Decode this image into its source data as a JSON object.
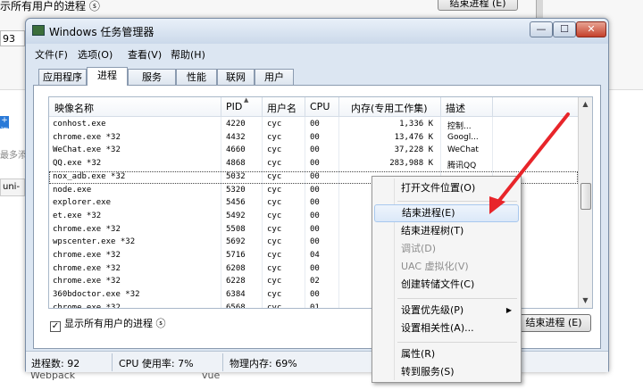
{
  "background": {
    "top_text": "示所有用户的进程 ⓢ",
    "top_button": "结束进程 (E)",
    "num_field": "93",
    "side_text_1": "+ 添",
    "side_text_2": "最多添",
    "side_text_3": "uni-",
    "bottom_text_1": "Webpack",
    "bottom_text_2": "vue"
  },
  "window": {
    "title": "Windows 任务管理器",
    "min": "—",
    "max": "☐",
    "close": "✕"
  },
  "menu": {
    "file": "文件(F)",
    "options": "选项(O)",
    "view": "查看(V)",
    "help": "帮助(H)"
  },
  "tabs": {
    "apps": "应用程序",
    "processes": "进程",
    "services": "服务",
    "performance": "性能",
    "network": "联网",
    "users": "用户"
  },
  "columns": {
    "name": "映像名称",
    "pid": "PID",
    "user": "用户名",
    "cpu": "CPU",
    "mem": "内存(专用工作集)",
    "desc": "描述"
  },
  "processes": [
    {
      "name": "conhost.exe",
      "pid": "4220",
      "user": "cyc",
      "cpu": "00",
      "mem": "1,336 K",
      "desc": "控制..."
    },
    {
      "name": "chrome.exe *32",
      "pid": "4432",
      "user": "cyc",
      "cpu": "00",
      "mem": "13,476 K",
      "desc": "Googl..."
    },
    {
      "name": "WeChat.exe *32",
      "pid": "4660",
      "user": "cyc",
      "cpu": "00",
      "mem": "37,228 K",
      "desc": "WeChat"
    },
    {
      "name": "QQ.exe *32",
      "pid": "4868",
      "user": "cyc",
      "cpu": "00",
      "mem": "283,988 K",
      "desc": "腾讯QQ"
    },
    {
      "name": "nox_adb.exe *32",
      "pid": "5032",
      "user": "cyc",
      "cpu": "00",
      "mem": "",
      "desc": ""
    },
    {
      "name": "node.exe",
      "pid": "5320",
      "user": "cyc",
      "cpu": "00",
      "mem": "",
      "desc": ""
    },
    {
      "name": "explorer.exe",
      "pid": "5456",
      "user": "cyc",
      "cpu": "00",
      "mem": "",
      "desc": ""
    },
    {
      "name": "et.exe *32",
      "pid": "5492",
      "user": "cyc",
      "cpu": "00",
      "mem": "",
      "desc": ""
    },
    {
      "name": "chrome.exe *32",
      "pid": "5508",
      "user": "cyc",
      "cpu": "00",
      "mem": "",
      "desc": ""
    },
    {
      "name": "wpscenter.exe *32",
      "pid": "5692",
      "user": "cyc",
      "cpu": "00",
      "mem": "",
      "desc": ""
    },
    {
      "name": "chrome.exe *32",
      "pid": "5716",
      "user": "cyc",
      "cpu": "04",
      "mem": "",
      "desc": ""
    },
    {
      "name": "chrome.exe *32",
      "pid": "6208",
      "user": "cyc",
      "cpu": "00",
      "mem": "",
      "desc": ""
    },
    {
      "name": "chrome.exe *32",
      "pid": "6228",
      "user": "cyc",
      "cpu": "02",
      "mem": "",
      "desc": ""
    },
    {
      "name": "360bdoctor.exe *32",
      "pid": "6384",
      "user": "cyc",
      "cpu": "00",
      "mem": "",
      "desc": ""
    },
    {
      "name": "chrome.exe *32",
      "pid": "6568",
      "user": "cyc",
      "cpu": "01",
      "mem": "",
      "desc": ""
    }
  ],
  "show_all_label": "显示所有用户的进程 ⓢ",
  "show_all_check": "✓",
  "end_process_button": "结束进程 (E)",
  "status": {
    "processes": "进程数: 92",
    "cpu": "CPU 使用率: 7%",
    "memory": "物理内存: 69%"
  },
  "context_menu": {
    "open_location": "打开文件位置(O)",
    "end_process": "结束进程(E)",
    "end_tree": "结束进程树(T)",
    "debug": "调试(D)",
    "uac": "UAC 虚拟化(V)",
    "dump": "创建转储文件(C)",
    "priority": "设置优先级(P)",
    "affinity": "设置相关性(A)...",
    "properties": "属性(R)",
    "goto_service": "转到服务(S)",
    "submenu_arrow": "▶"
  },
  "colors": {
    "arrow": "#e8252a",
    "window_frame": "#dce6f2",
    "menu_hover": "#dbe8f8"
  }
}
